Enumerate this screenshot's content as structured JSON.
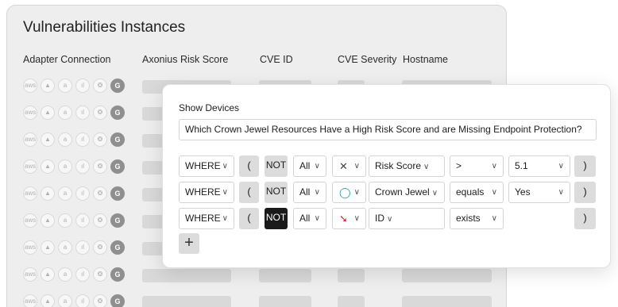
{
  "table": {
    "title": "Vulnerabilities Instances",
    "columns": [
      "Adapter Connection",
      "Axonius Risk Score",
      "CVE ID",
      "CVE Severity",
      "Hostname"
    ],
    "adapter_icons": [
      "aws-icon",
      "azure-icon",
      "amazon-icon",
      "bars-icon",
      "badge-icon",
      "globe-icon"
    ],
    "adapter_glyphs": [
      "aws",
      "▲",
      "a",
      "ıl",
      "❂",
      "G"
    ],
    "row_count": 9
  },
  "modal": {
    "title": "Show Devices",
    "query": "Which Crown Jewel Resources Have a High Risk Score and are Missing Endpoint Protection?",
    "filters": [
      {
        "where": "WHERE",
        "open_paren": "(",
        "not": "NOT",
        "not_active": false,
        "scope": "All",
        "adapter_icon": "axonius-x-icon",
        "adapter_glyph": "✕",
        "field": "Risk Score",
        "operator": ">",
        "value": "5.1",
        "close_paren": ")"
      },
      {
        "where": "WHERE",
        "open_paren": "(",
        "not": "NOT",
        "not_active": false,
        "scope": "All",
        "adapter_icon": "ring-icon",
        "adapter_glyph": "◯",
        "field": "Crown Jewel",
        "operator": "equals",
        "value": "Yes",
        "close_paren": ")"
      },
      {
        "where": "WHERE",
        "open_paren": "(",
        "not": "NOT",
        "not_active": true,
        "scope": "All",
        "adapter_icon": "falcon-icon",
        "adapter_glyph": "➘",
        "field": "ID",
        "operator": "exists",
        "value": "",
        "close_paren": ")"
      }
    ],
    "add_label": "+"
  },
  "colors": {
    "not_active_bg": "#1a1a1a",
    "ring": "#22a39a",
    "falcon": "#d6262b"
  }
}
